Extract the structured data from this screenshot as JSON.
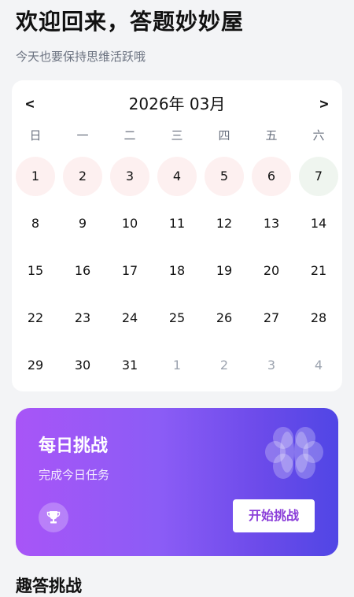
{
  "header": {
    "title": "欢迎回来，答题妙妙屋",
    "subtitle": "今天也要保持思维活跃哦"
  },
  "calendar": {
    "prev_label": "<",
    "next_label": ">",
    "month_label": "2026年 03月",
    "weekdays": [
      "日",
      "一",
      "二",
      "三",
      "四",
      "五",
      "六"
    ],
    "days": [
      {
        "label": "1",
        "state": "done"
      },
      {
        "label": "2",
        "state": "done"
      },
      {
        "label": "3",
        "state": "done"
      },
      {
        "label": "4",
        "state": "done"
      },
      {
        "label": "5",
        "state": "done"
      },
      {
        "label": "6",
        "state": "done"
      },
      {
        "label": "7",
        "state": "today"
      },
      {
        "label": "8",
        "state": "normal"
      },
      {
        "label": "9",
        "state": "normal"
      },
      {
        "label": "10",
        "state": "normal"
      },
      {
        "label": "11",
        "state": "normal"
      },
      {
        "label": "12",
        "state": "normal"
      },
      {
        "label": "13",
        "state": "normal"
      },
      {
        "label": "14",
        "state": "normal"
      },
      {
        "label": "15",
        "state": "normal"
      },
      {
        "label": "16",
        "state": "normal"
      },
      {
        "label": "17",
        "state": "normal"
      },
      {
        "label": "18",
        "state": "normal"
      },
      {
        "label": "19",
        "state": "normal"
      },
      {
        "label": "20",
        "state": "normal"
      },
      {
        "label": "21",
        "state": "normal"
      },
      {
        "label": "22",
        "state": "normal"
      },
      {
        "label": "23",
        "state": "normal"
      },
      {
        "label": "24",
        "state": "normal"
      },
      {
        "label": "25",
        "state": "normal"
      },
      {
        "label": "26",
        "state": "normal"
      },
      {
        "label": "27",
        "state": "normal"
      },
      {
        "label": "28",
        "state": "normal"
      },
      {
        "label": "29",
        "state": "normal"
      },
      {
        "label": "30",
        "state": "normal"
      },
      {
        "label": "31",
        "state": "normal"
      },
      {
        "label": "1",
        "state": "other"
      },
      {
        "label": "2",
        "state": "other"
      },
      {
        "label": "3",
        "state": "other"
      },
      {
        "label": "4",
        "state": "other"
      }
    ]
  },
  "daily_challenge": {
    "title": "每日挑战",
    "subtitle": "完成今日任务",
    "button_label": "开始挑战",
    "decor_icon": "brain-icon",
    "badge_icon": "trophy-icon",
    "gradient_start": "#a855f7",
    "gradient_end": "#5046e5",
    "button_text_color": "#8b3fd9"
  },
  "section": {
    "title": "趣答挑战"
  },
  "colors": {
    "done_day_bg": "#fdf0f0",
    "today_bg": "#eff5ef",
    "page_bg": "#f3f4f6"
  }
}
